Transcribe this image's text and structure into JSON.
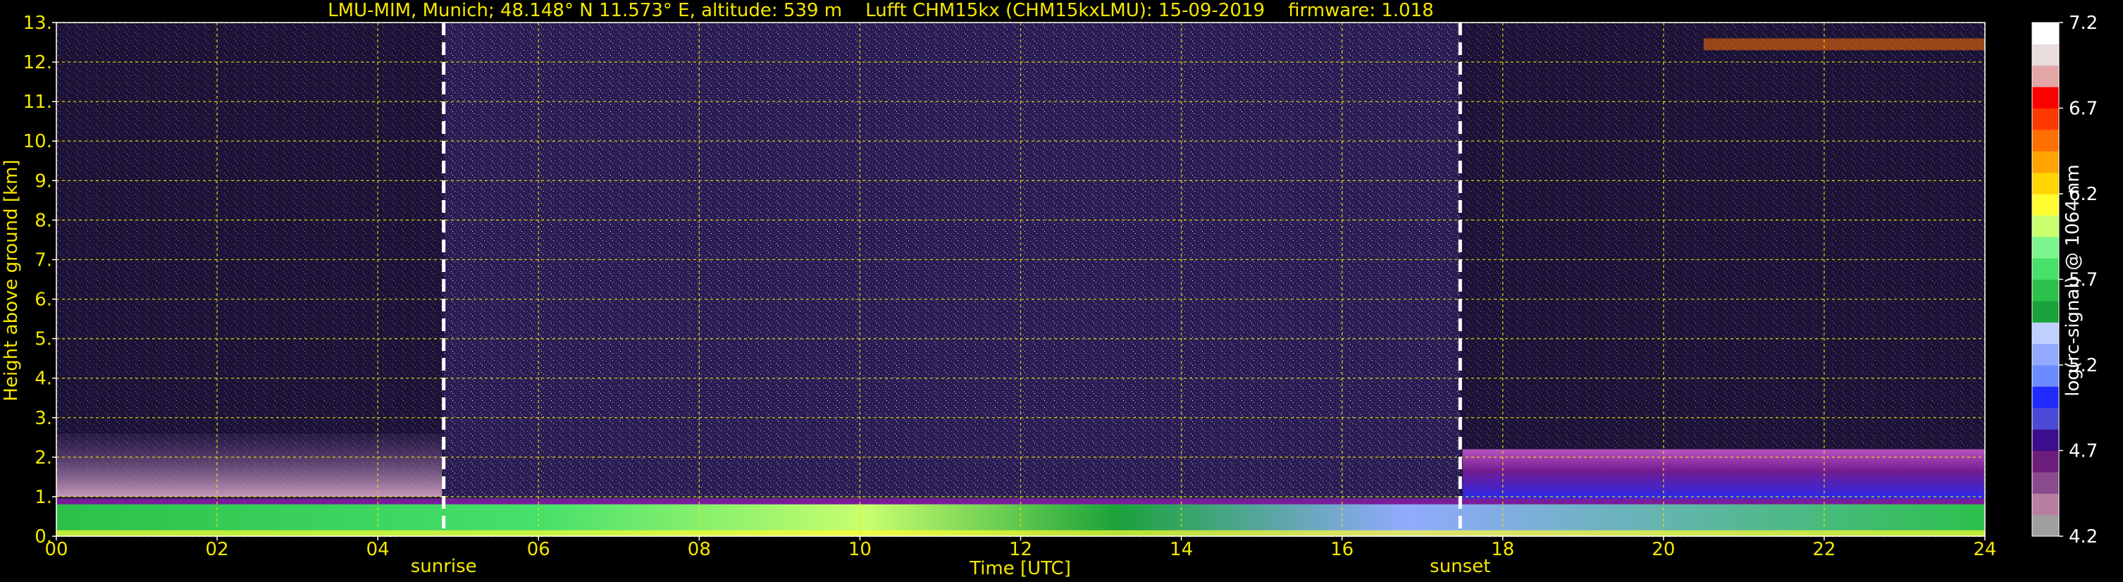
{
  "chart_data": {
    "type": "heatmap",
    "title": "LMU-MIM, Munich; 48.148° N 11.573° E, altitude: 539 m    Lufft CHM15kx (CHM15kxLMU): 15-09-2019    firmware: 1.018",
    "xlabel": "Time [UTC]",
    "ylabel": "Height above ground [km]",
    "xlim": [
      0,
      24
    ],
    "ylim": [
      0,
      13
    ],
    "x_ticks": [
      "00",
      "02",
      "04",
      "06",
      "08",
      "10",
      "12",
      "14",
      "16",
      "18",
      "20",
      "22",
      "24"
    ],
    "y_ticks": [
      "0.",
      "1.",
      "2.",
      "3.",
      "4.",
      "5.",
      "6.",
      "7.",
      "8.",
      "9.",
      "10.",
      "11.",
      "12.",
      "13."
    ],
    "grid": true,
    "events": [
      {
        "label": "sunrise",
        "x": 4.82
      },
      {
        "label": "sunset",
        "x": 17.47
      }
    ],
    "colorbar": {
      "label": "log(rc-signal) @ 1064 nm",
      "range": [
        4.2,
        7.2
      ],
      "ticks": [
        "4.2",
        "4.7",
        "5.2",
        "5.7",
        "6.2",
        "6.7",
        "7.2"
      ],
      "colors": [
        "#9f9f9f",
        "#b97fa3",
        "#8b4a8e",
        "#6c1c7a",
        "#3c0d8c",
        "#4a4ad6",
        "#1f2bff",
        "#6a8cff",
        "#91aaff",
        "#bfcfff",
        "#1aa23a",
        "#2bc14a",
        "#46e06b",
        "#7cf58c",
        "#c8ff6e",
        "#fffc32",
        "#ffd400",
        "#ffa300",
        "#ff7000",
        "#ff3a00",
        "#ff0000",
        "#e2a6a6",
        "#e8dcdc",
        "#ffffff"
      ]
    },
    "layers": [
      {
        "name": "near-surface aerosol layer",
        "x": [
          0,
          24
        ],
        "top_km": [
          0.95,
          0.95
        ]
      },
      {
        "name": "residual layer",
        "x": [
          0,
          4.8
        ],
        "top_km": [
          2.6,
          2.6
        ]
      },
      {
        "name": "evening residual layer",
        "x": [
          17.5,
          24
        ],
        "top_km": [
          2.1,
          2.2
        ]
      },
      {
        "name": "cirrus",
        "x": [
          20.5,
          24
        ],
        "height_km": [
          12.3,
          12.6
        ]
      }
    ]
  }
}
